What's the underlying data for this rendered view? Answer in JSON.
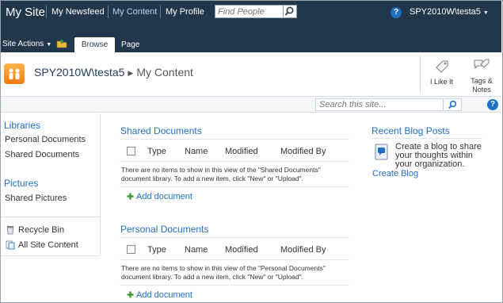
{
  "topbar": {
    "site_title": "My Site",
    "links": [
      "My Newsfeed",
      "My Content",
      "My Profile"
    ],
    "find_placeholder": "Find People",
    "user": "SPY2010W\\testa5"
  },
  "ribbon": {
    "site_actions": "Site Actions",
    "tabs": [
      "Browse",
      "Page"
    ]
  },
  "title_area": {
    "site": "SPY2010W\\testa5",
    "page": "My Content",
    "like_label": "I Like It",
    "tags_label_1": "Tags &",
    "tags_label_2": "Notes"
  },
  "search": {
    "placeholder": "Search this site..."
  },
  "left_nav": {
    "libraries_heading": "Libraries",
    "libraries": [
      "Personal Documents",
      "Shared Documents"
    ],
    "pictures_heading": "Pictures",
    "pictures": [
      "Shared Pictures"
    ],
    "recycle_bin": "Recycle Bin",
    "all_content": "All Site Content"
  },
  "shared_documents": {
    "title": "Shared Documents",
    "columns": [
      "Type",
      "Name",
      "Modified",
      "Modified By"
    ],
    "empty_line1": "There are no items to show in this view of the \"Shared Documents\"",
    "empty_line2": "document library. To add a new item, click \"New\" or \"Upload\".",
    "add_label": "Add document"
  },
  "personal_documents": {
    "title": "Personal Documents",
    "columns": [
      "Type",
      "Name",
      "Modified",
      "Modified By"
    ],
    "empty_line1": "There are no items to show in this view of the \"Personal Documents\"",
    "empty_line2": "document library. To add a new item, click \"New\" or \"Upload\".",
    "add_label": "Add document"
  },
  "blog": {
    "title": "Recent Blog Posts",
    "text": "Create a blog to share your thoughts within your organization.",
    "create_label": "Create Blog"
  },
  "colors": {
    "navy": "#21374c",
    "link_blue": "#1f6fc5"
  }
}
